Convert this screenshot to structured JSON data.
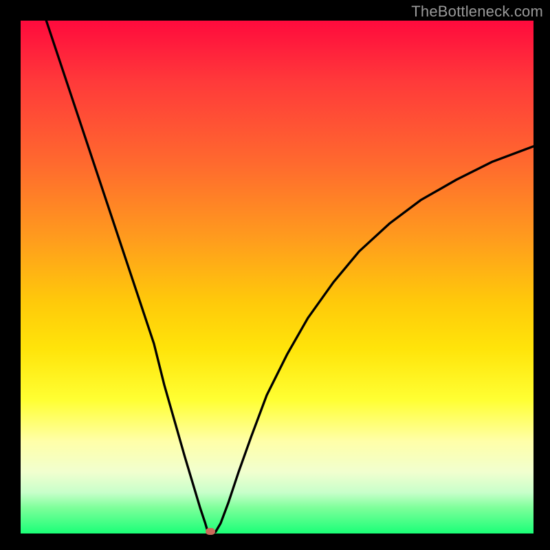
{
  "watermark": "TheBottleneck.com",
  "chart_data": {
    "type": "line",
    "title": "",
    "xlabel": "",
    "ylabel": "",
    "xlim": [
      0,
      100
    ],
    "ylim": [
      0,
      100
    ],
    "series": [
      {
        "name": "left-branch",
        "x": [
          5,
          8,
          11,
          14,
          17,
          20,
          23,
          26,
          28,
          30,
          32,
          33.5,
          35,
          36,
          36.5
        ],
        "y": [
          100,
          91,
          82,
          73,
          64,
          55,
          46,
          37,
          29,
          22,
          15,
          10,
          5,
          2,
          0.3
        ]
      },
      {
        "name": "right-branch",
        "x": [
          38,
          39,
          40.5,
          42.5,
          45,
          48,
          52,
          56,
          61,
          66,
          72,
          78,
          85,
          92,
          100
        ],
        "y": [
          0.3,
          2,
          6,
          12,
          19,
          27,
          35,
          42,
          49,
          55,
          60.5,
          65,
          69,
          72.5,
          75.5
        ]
      }
    ],
    "marker": {
      "x": 37,
      "y": 0.4
    },
    "colors": {
      "curve": "#000000",
      "marker": "#c96a5a",
      "gradient_top": "#ff0a3d",
      "gradient_bottom": "#1aff77",
      "frame": "#000000"
    }
  }
}
